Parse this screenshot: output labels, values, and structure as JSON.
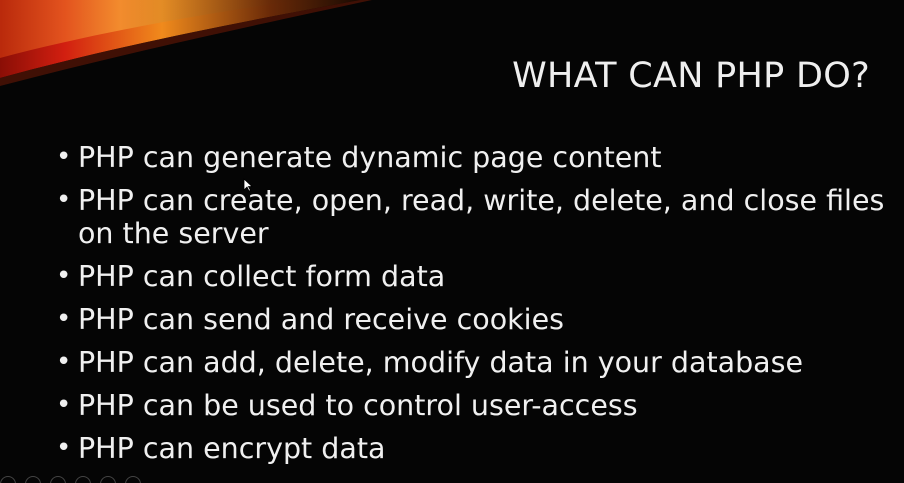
{
  "slide": {
    "title": "WHAT CAN PHP DO?",
    "bullets": [
      "PHP can generate dynamic page content",
      "PHP can create, open, read, write, delete, and close files on the server",
      "PHP can collect form data",
      "PHP can send and receive cookies",
      "PHP can add, delete, modify data in your database",
      "PHP can be used to control user-access",
      "PHP can encrypt data"
    ],
    "bullet_glyph": "•"
  },
  "colors": {
    "background": "#050505",
    "text": "#f0f0f0",
    "swoosh_red": "#d21f10",
    "swoosh_orange": "#f08a1c"
  },
  "icons": {
    "cursor": "mouse-pointer-icon"
  }
}
